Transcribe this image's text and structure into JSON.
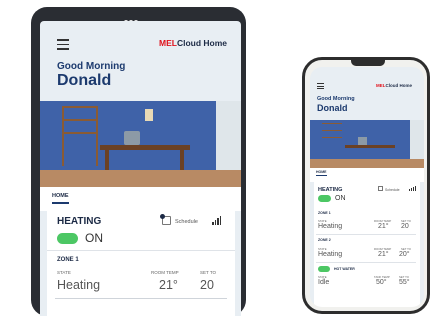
{
  "app": {
    "brand_mel": "MEL",
    "brand_rest": "Cloud Home"
  },
  "greeting": {
    "line1": "Good Morning",
    "name": "Donald"
  },
  "nav": {
    "tab_home": "HOME"
  },
  "heating": {
    "title": "HEATING",
    "state": "ON",
    "schedule_label": "Schedule",
    "toggle_on": true
  },
  "labels": {
    "state": "STATE",
    "room_temp": "ROOM TEMP",
    "set_to": "SET TO",
    "tank_temp": "TANK TEMP"
  },
  "zone1": {
    "name": "ZONE 1",
    "state": "Heating",
    "room_temp": "21°",
    "set_to": "20"
  },
  "zone2": {
    "name": "ZONE 2",
    "state": "Heating",
    "room_temp": "21°",
    "set_to": "20°"
  },
  "hot_water": {
    "title": "HOT WATER",
    "state": "Idle",
    "tank_temp": "50°",
    "set_temp": "55°"
  },
  "colors": {
    "brand_red": "#e0111b",
    "navy": "#1c3a6e",
    "toggle_green": "#4cc764",
    "device_frame": "#2a2d33"
  }
}
